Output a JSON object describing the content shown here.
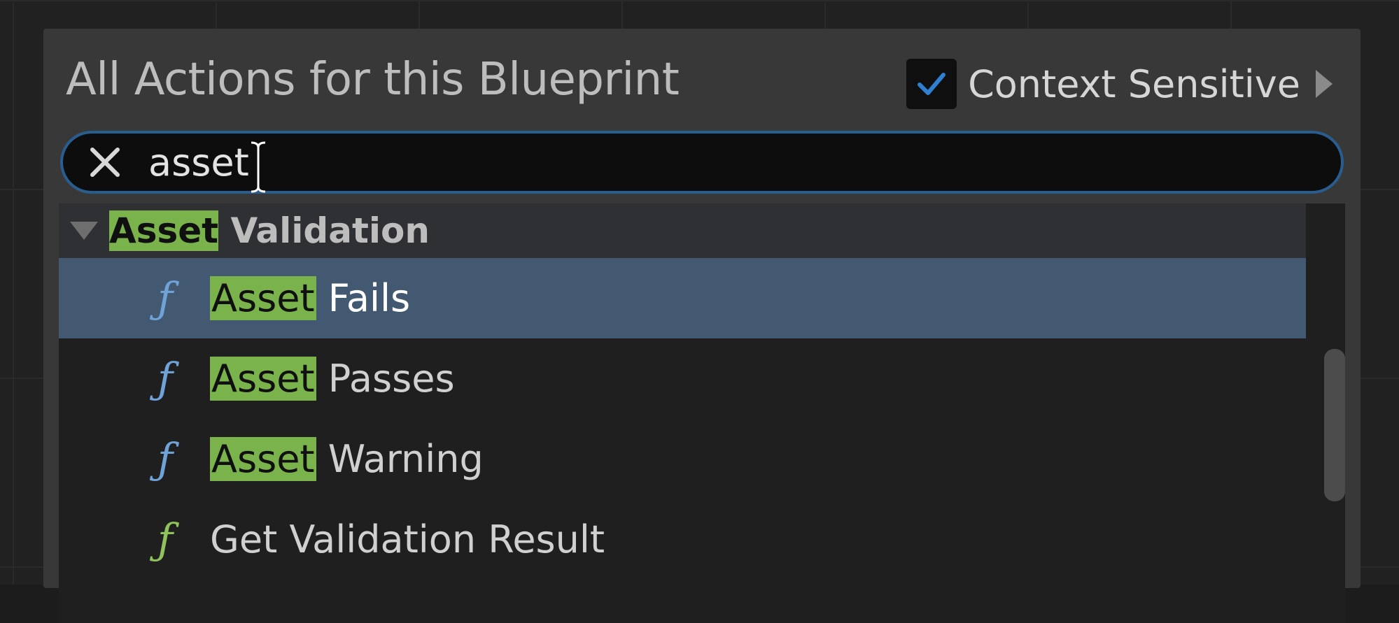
{
  "panel": {
    "title": "All Actions for this Blueprint",
    "context_sensitive": {
      "label": "Context Sensitive",
      "checked": true
    }
  },
  "search": {
    "value": "asset",
    "placeholder": ""
  },
  "results": {
    "category": {
      "highlight": "Asset",
      "rest": " Validation",
      "expanded": true
    },
    "items": [
      {
        "icon": "function-icon",
        "highlight": "Asset",
        "rest": " Fails",
        "selected": true,
        "icon_color": "#6fa3d8"
      },
      {
        "icon": "function-icon",
        "highlight": "Asset",
        "rest": " Passes",
        "selected": false,
        "icon_color": "#6fa3d8"
      },
      {
        "icon": "function-icon",
        "highlight": "Asset",
        "rest": " Warning",
        "selected": false,
        "icon_color": "#6fa3d8"
      },
      {
        "icon": "function-icon",
        "highlight": "",
        "rest": "Get Validation Result",
        "selected": false,
        "icon_color": "#8fc25a"
      }
    ]
  },
  "colors": {
    "highlight": "#7ab34c",
    "selected_row": "#435871",
    "focus_border": "#2a5d8f",
    "checkbox_check": "#2f7fd3"
  },
  "icons": {
    "func_glyph": "ƒ"
  }
}
